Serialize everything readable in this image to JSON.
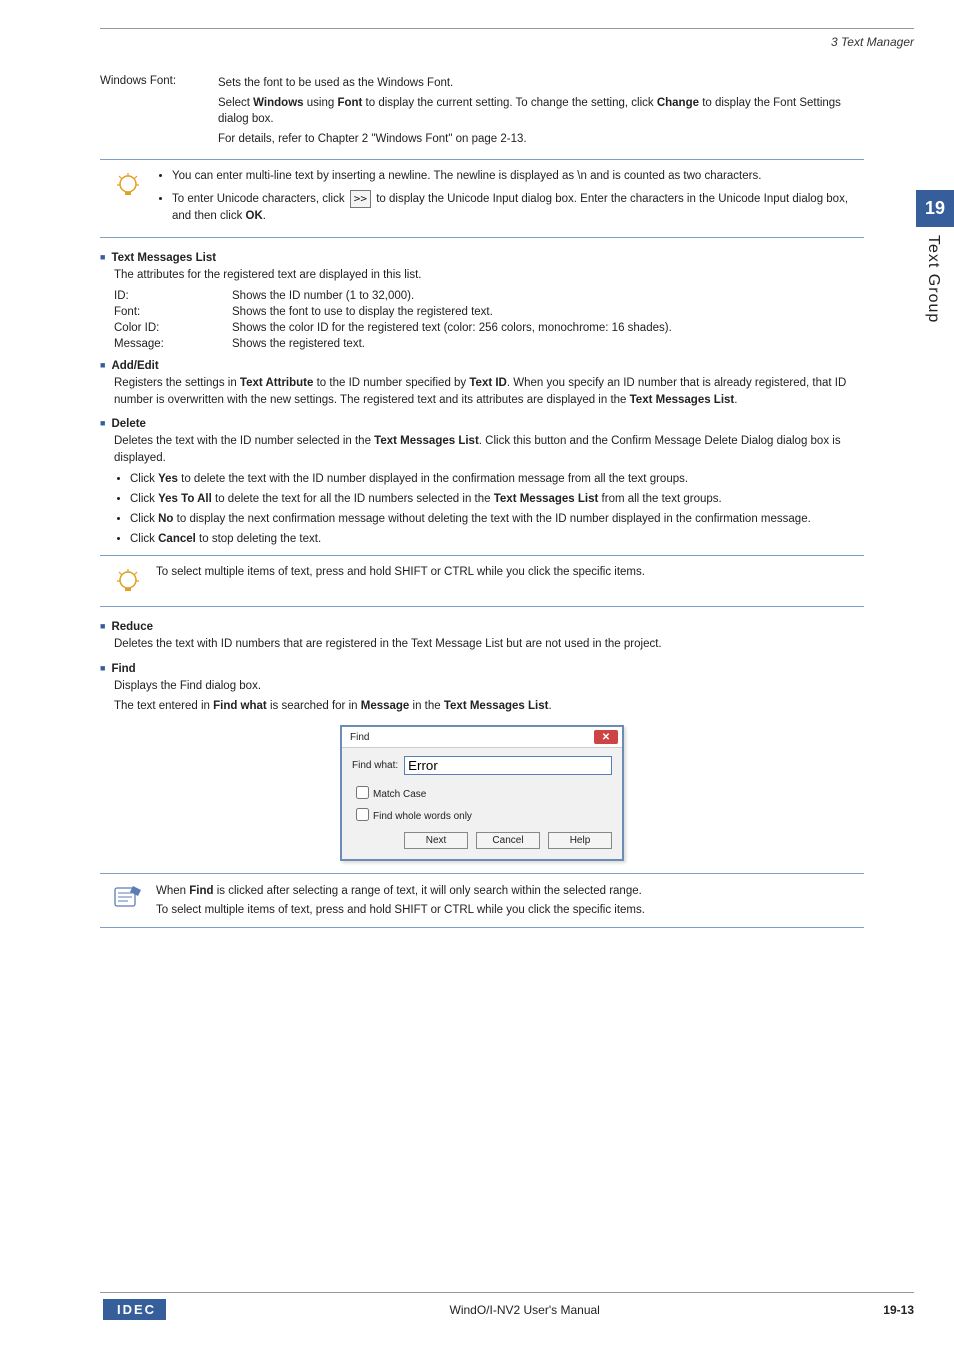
{
  "header": {
    "breadcrumb": "3 Text Manager"
  },
  "sideTab": {
    "chapter": "19",
    "title": "Text Group"
  },
  "windowsFont": {
    "label": "Windows Font:",
    "line1": "Sets the font to be used as the Windows Font.",
    "line2a": "Select ",
    "line2b": "Windows",
    "line2c": " using ",
    "line2d": "Font",
    "line2e": " to display the current setting. To change the setting, click ",
    "line2f": "Change",
    "line2g": " to display the Font Settings dialog box.",
    "line3": "For details, refer to Chapter 2 \"Windows Font\" on page 2-13."
  },
  "tip1": {
    "bullet1": "You can enter multi-line text by inserting a newline. The newline is displayed as \\n and is counted as two characters.",
    "bullet2a": "To enter Unicode characters, click ",
    "bullet2b": " to display the Unicode Input dialog box. Enter the characters in the Unicode Input dialog box, and then click ",
    "bullet2c": "OK",
    "bullet2d": "."
  },
  "textMessagesList": {
    "title": "Text Messages List",
    "intro": "The attributes for the registered text are displayed in this list.",
    "rows": {
      "id": {
        "label": "ID:",
        "desc": "Shows the ID number (1 to 32,000)."
      },
      "font": {
        "label": "Font:",
        "desc": "Shows the font to use to display the registered text."
      },
      "colorId": {
        "label": "Color ID:",
        "desc": "Shows the color ID for the registered text (color: 256 colors, monochrome: 16 shades)."
      },
      "message": {
        "label": "Message:",
        "desc": "Shows the registered text."
      }
    }
  },
  "addEdit": {
    "title": "Add/Edit",
    "p1a": "Registers the settings in ",
    "p1b": "Text Attribute",
    "p1c": " to the ID number specified by ",
    "p1d": "Text ID",
    "p1e": ". When you specify an ID number that is already registered, that ID number is overwritten with the new settings. The registered text and its attributes are displayed in the ",
    "p1f": "Text Messages List",
    "p1g": "."
  },
  "delete": {
    "title": "Delete",
    "p1a": "Deletes the text with the ID number selected in the ",
    "p1b": "Text Messages List",
    "p1c": ". Click this button and the Confirm Message Delete Dialog dialog box is displayed.",
    "li1a": "Click ",
    "li1b": "Yes",
    "li1c": " to delete the text with the ID number displayed in the confirmation message from all the text groups.",
    "li2a": "Click ",
    "li2b": "Yes To All",
    "li2c": " to delete the text for all the ID numbers selected in the ",
    "li2d": "Text Messages List",
    "li2e": " from all the text groups.",
    "li3a": "Click ",
    "li3b": "No",
    "li3c": " to display the next confirmation message without deleting the text with the ID number displayed in the confirmation message.",
    "li4a": "Click ",
    "li4b": "Cancel",
    "li4c": " to stop deleting the text."
  },
  "tip2": {
    "text": "To select multiple items of text, press and hold SHIFT or CTRL while you click the specific items."
  },
  "reduce": {
    "title": "Reduce",
    "p1": "Deletes the text with ID numbers that are registered in the Text Message List but are not used in the project."
  },
  "find": {
    "title": "Find",
    "p1": "Displays the Find dialog box.",
    "p2a": "The text entered in ",
    "p2b": "Find what",
    "p2c": " is searched for in ",
    "p2d": "Message",
    "p2e": " in the ",
    "p2f": "Text Messages List",
    "p2g": "."
  },
  "findDialog": {
    "title": "Find",
    "findWhatLabel": "Find what:",
    "findWhatValue": "Error",
    "matchCase": "Match Case",
    "wholeWords": "Find whole words only",
    "next": "Next",
    "cancel": "Cancel",
    "help": "Help"
  },
  "note1": {
    "line1a": "When ",
    "line1b": "Find",
    "line1c": " is clicked after selecting a range of text, it will only search within the selected range.",
    "line2": "To select multiple items of text, press and hold SHIFT or CTRL while you click the specific items."
  },
  "footer": {
    "logo": "IDEC",
    "center": "WindO/I-NV2 User's Manual",
    "page": "19-13"
  }
}
